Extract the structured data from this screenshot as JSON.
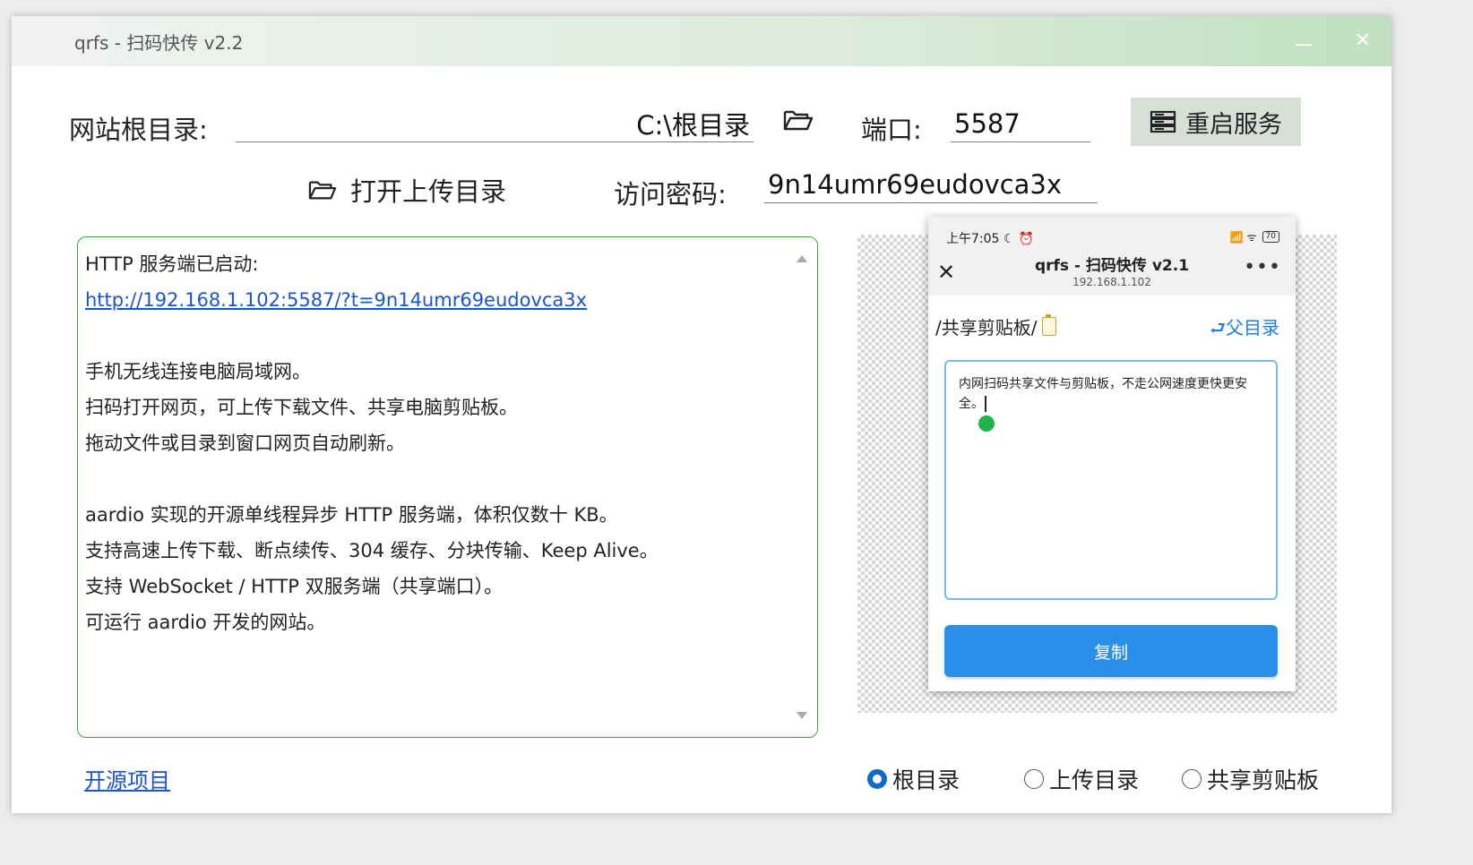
{
  "window": {
    "title": "qrfs - 扫码快传  v2.2",
    "minimize_glyph": "—",
    "close_glyph": "✕"
  },
  "settings": {
    "root_label": "网站根目录:",
    "root_value": "C:\\根目录",
    "port_label": "端口:",
    "port_value": "5587",
    "restart_label": "重启服务",
    "open_upload_label": "打开上传目录",
    "password_label": "访问密码:",
    "password_value": "9n14umr69eudovca3x"
  },
  "log": {
    "lines": [
      "HTTP 服务端已启动:",
      "http://192.168.1.102:5587/?t=9n14umr69eudovca3x",
      "",
      "手机无线连接电脑局域网。",
      "扫码打开网页，可上传下载文件、共享电脑剪贴板。",
      "拖动文件或目录到窗口网页自动刷新。",
      "",
      "aardio 实现的开源单线程异步 HTTP 服务端，体积仅数十 KB。",
      "支持高速上传下载、断点续传、304 缓存、分块传输、Keep Alive。",
      "支持 WebSocket / HTTP 双服务端（共享端口）。",
      "可运行 aardio 开发的网站。"
    ]
  },
  "phone_preview": {
    "status_time": "上午7:05",
    "status_time_icons": "☾ ⏰",
    "signal_icons": "📶 ᯤ",
    "battery_level": "70",
    "close_glyph": "✕",
    "title": "qrfs - 扫码快传 v2.1",
    "host": "192.168.1.102",
    "more_glyph": "•••",
    "path": "/共享剪贴板/",
    "parent_dir": "⮐父目录",
    "text_content": "内网扫码共享文件与剪贴板，不走公网速度更快更安全。",
    "copy_label": "复制"
  },
  "footer": {
    "open_source_link": "开源项目",
    "radio_options": [
      {
        "label": "根目录",
        "checked": true
      },
      {
        "label": "上传目录",
        "checked": false
      },
      {
        "label": "共享剪贴板",
        "checked": false
      }
    ]
  },
  "colors": {
    "accent_green": "#3ba23b",
    "link_blue": "#1a56c9",
    "phone_button_blue": "#2b8ee8",
    "radio_checked": "#0f6bc6"
  }
}
